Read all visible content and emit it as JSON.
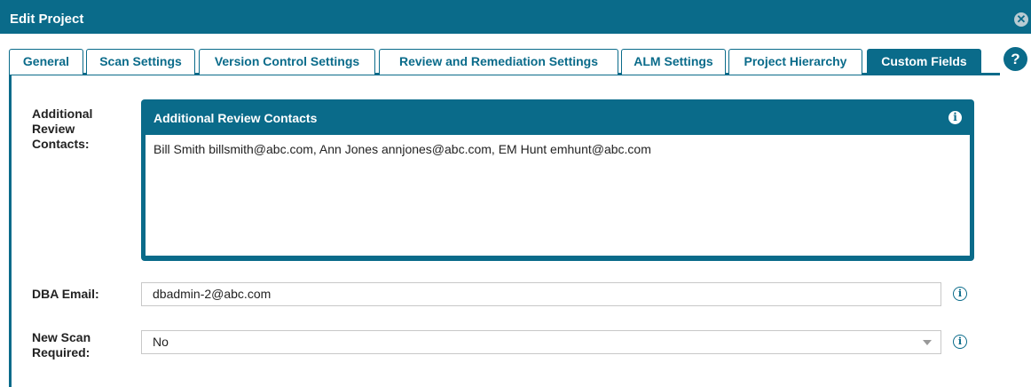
{
  "window": {
    "title": "Edit Project",
    "close_glyph": "✕",
    "help_glyph": "?"
  },
  "tabs": [
    {
      "label": "General"
    },
    {
      "label": "Scan Settings"
    },
    {
      "label": "Version Control Settings"
    },
    {
      "label": "Review and Remediation Settings"
    },
    {
      "label": "ALM Settings"
    },
    {
      "label": "Project Hierarchy"
    },
    {
      "label": "Custom Fields",
      "active": true
    }
  ],
  "form": {
    "review_contacts": {
      "label_lines": [
        "Additional",
        "Review",
        "Contacts:"
      ],
      "panel_title": "Additional Review Contacts",
      "value": "Bill Smith billsmith@abc.com, Ann Jones annjones@abc.com, EM Hunt emhunt@abc.com"
    },
    "dba_email": {
      "label": "DBA Email:",
      "value": "dbadmin-2@abc.com"
    },
    "new_scan_required": {
      "label_lines": [
        "New Scan",
        "Required:"
      ],
      "value": "No"
    },
    "info_glyph": "i"
  },
  "colors": {
    "accent": "#0a6b8a",
    "background": "#ffffff"
  },
  "icons": [
    "close-icon",
    "help-icon",
    "info-icon",
    "chevron-down-icon"
  ]
}
